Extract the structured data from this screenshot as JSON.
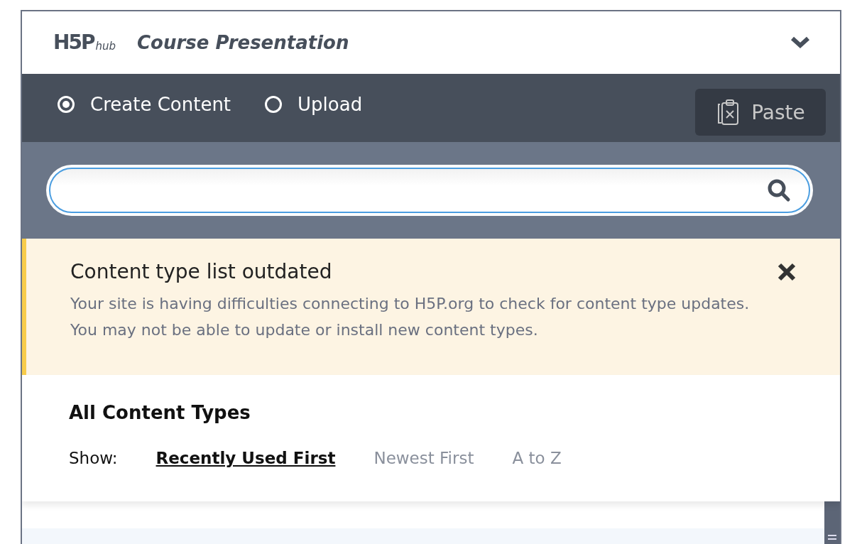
{
  "header": {
    "logo": {
      "mark": "H5P",
      "suffix": "hub"
    },
    "title": "Course Presentation",
    "expanded": true
  },
  "modes": [
    {
      "label": "Create Content",
      "selected": true
    },
    {
      "label": "Upload",
      "selected": false
    }
  ],
  "paste_button": {
    "label": "Paste",
    "disabled": true
  },
  "notice": {
    "title": "Content type list outdated",
    "message": "Your site is having difficulties connecting to H5P.org to check for content type updates. You may not be able to update or install new content types."
  },
  "list": {
    "title": "All Content Types",
    "show_label": "Show:",
    "sort_options": [
      {
        "label": "Recently Used First",
        "selected": true
      },
      {
        "label": "Newest First",
        "selected": false
      },
      {
        "label": "A to Z",
        "selected": false
      }
    ]
  }
}
